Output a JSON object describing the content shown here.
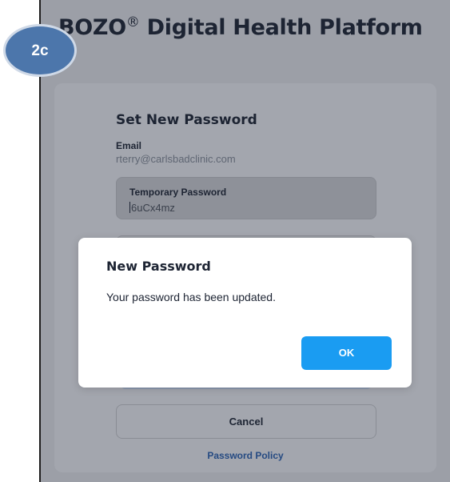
{
  "step_badge": "2c",
  "app": {
    "title": "BOZO",
    "registered": "®",
    "title_suffix": " Digital Health Platform"
  },
  "form": {
    "title": "Set New Password",
    "email_label": "Email",
    "email_value": "rterry@carlsbadclinic.com",
    "temp_password_label": "Temporary Password",
    "temp_password_value": "6uCx4mz",
    "cancel_label": "Cancel",
    "policy_link": "Password Policy"
  },
  "modal": {
    "title": "New Password",
    "message": "Your password has been updated.",
    "ok_label": "OK"
  },
  "colors": {
    "ok_button": "#1a9cf2",
    "badge": "#4c76ab",
    "overlay": "#9c9fa7"
  }
}
